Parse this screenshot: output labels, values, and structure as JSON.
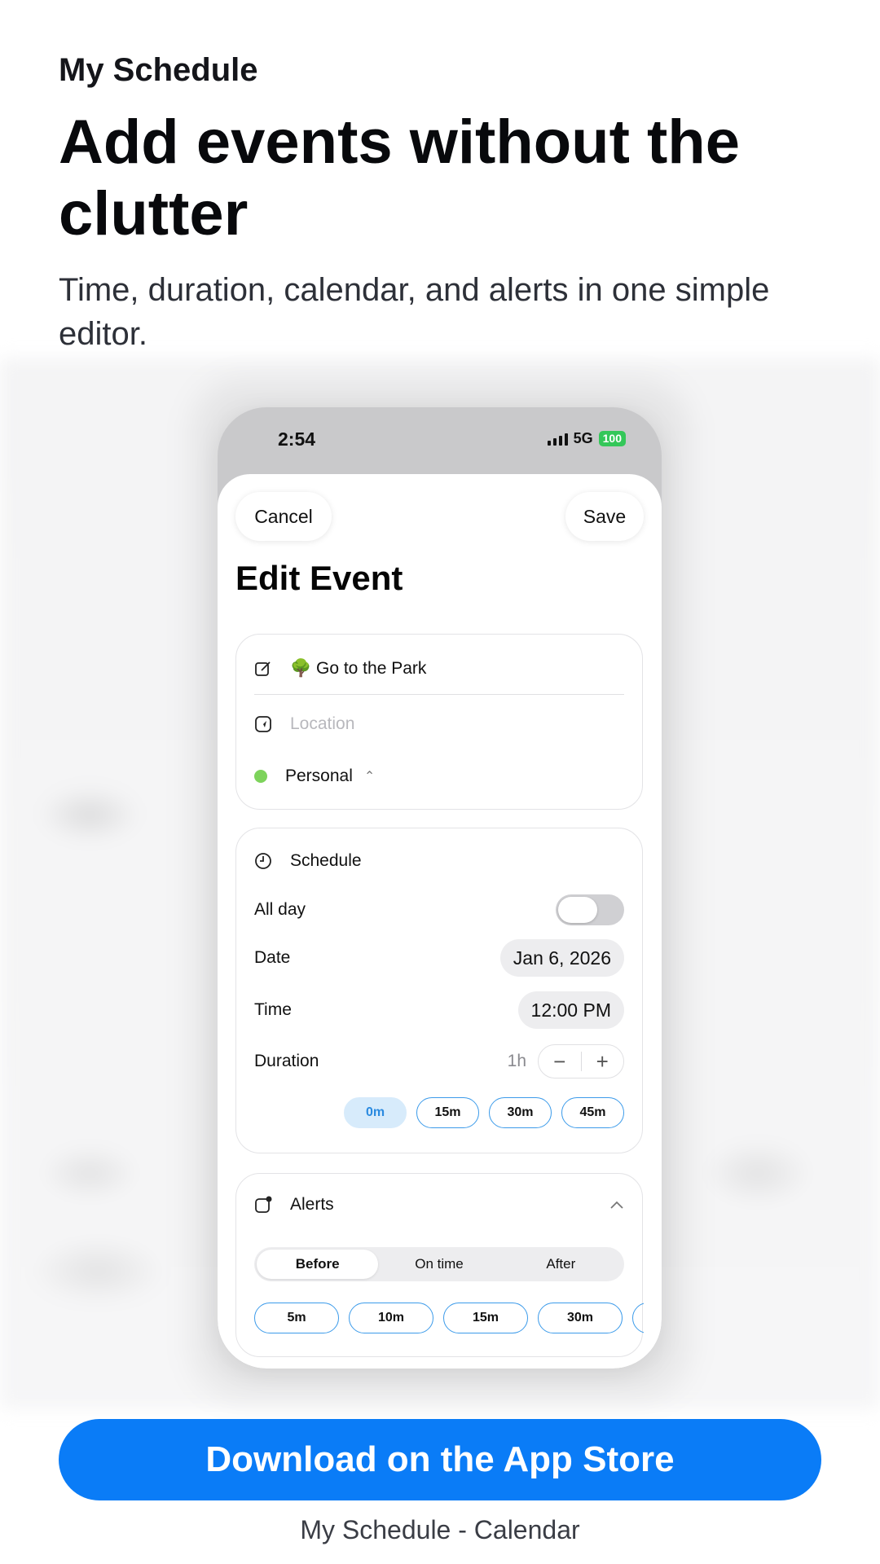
{
  "header": {
    "app_name": "My Schedule",
    "headline": "Add events without the clutter",
    "subline": "Time, duration, calendar, and alerts in one simple editor."
  },
  "status_bar": {
    "time": "2:54",
    "network": "5G",
    "battery": "100"
  },
  "editor": {
    "cancel_label": "Cancel",
    "save_label": "Save",
    "title": "Edit Event",
    "event_title": "🌳 Go to the Park",
    "location_placeholder": "Location",
    "calendar_name": "Personal",
    "calendar_color": "#7dd35b"
  },
  "schedule": {
    "section_label": "Schedule",
    "all_day_label": "All day",
    "all_day_on": false,
    "date_label": "Date",
    "date_value": "Jan 6, 2026",
    "time_label": "Time",
    "time_value": "12:00 PM",
    "duration_label": "Duration",
    "duration_value": "1h",
    "minus_symbol": "−",
    "plus_symbol": "+",
    "minute_chips": [
      "0m",
      "15m",
      "30m",
      "45m"
    ],
    "selected_chip": "0m"
  },
  "alerts": {
    "section_label": "Alerts",
    "segments": [
      "Before",
      "On time",
      "After"
    ],
    "selected_segment": "Before",
    "chips": [
      "5m",
      "10m",
      "15m",
      "30m",
      ""
    ]
  },
  "cta": {
    "label": "Download on the App Store",
    "color": "#0a7cf7"
  },
  "footer": {
    "caption": "My Schedule - Calendar"
  }
}
